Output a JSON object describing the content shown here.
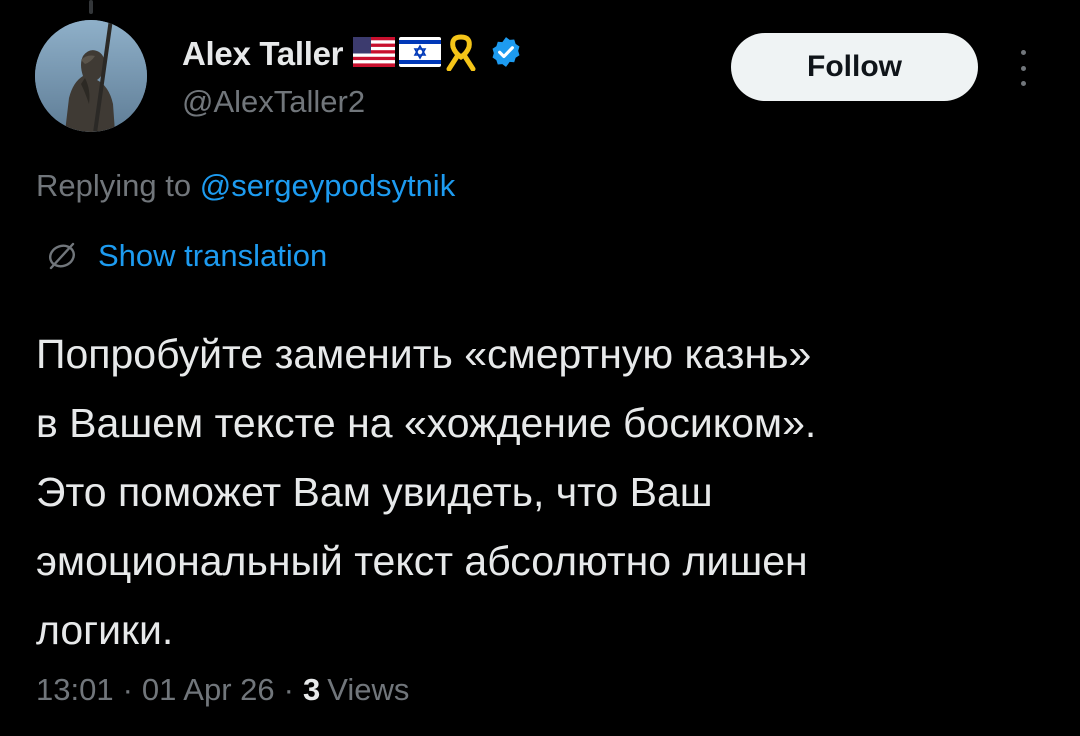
{
  "author": {
    "display_name": "Alex Taller",
    "handle": "@AlexTaller2",
    "emoji_badges": [
      "us-flag-icon",
      "israel-flag-icon",
      "yellow-ribbon-icon"
    ],
    "verified": true
  },
  "follow_label": "Follow",
  "reply_context": {
    "prefix": "Replying to",
    "mention": "@sergeypodsytnik"
  },
  "translation_label": "Show translation",
  "tweet_lines": [
    "Попробуйте заменить «смертную казнь»",
    "в Вашем тексте на «хождение босиком».",
    "Это поможет Вам увидеть, что Ваш",
    "эмоциональный текст абсолютно лишен",
    "логики."
  ],
  "meta": {
    "time": "13:01",
    "date": "01 Apr 26",
    "separator": "·",
    "views_count": "3",
    "views_label": "Views"
  },
  "colors": {
    "background": "#000000",
    "text_primary": "#e7e9ea",
    "text_secondary": "#71767b",
    "accent_blue": "#1d9bf0",
    "button_bg": "#eff3f4"
  }
}
